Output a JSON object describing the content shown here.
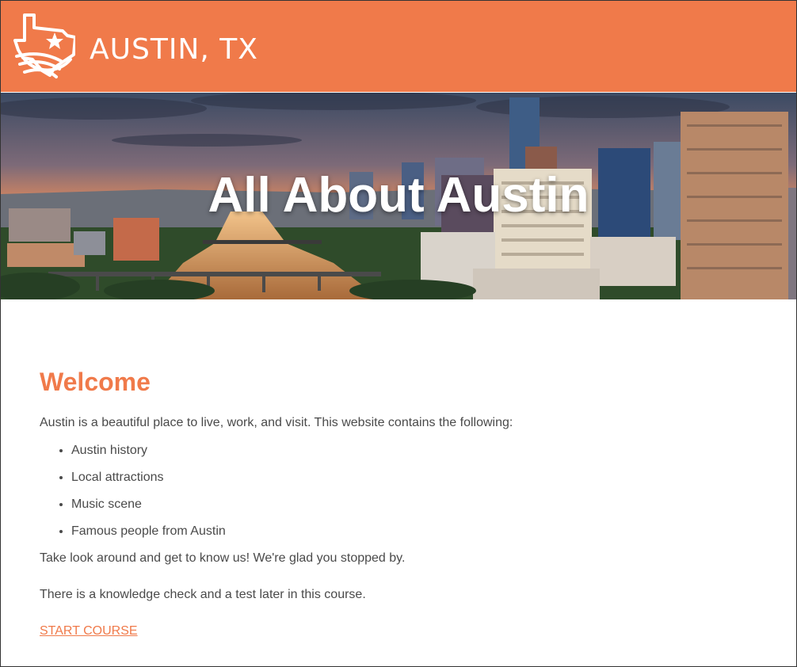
{
  "colors": {
    "brand": "#F07A4A",
    "text": "#4A4A4A",
    "white": "#FFFFFF"
  },
  "header": {
    "logo_icon": "texas-outline-star-icon",
    "title": "AUSTIN, TX"
  },
  "hero": {
    "title": "All About Austin",
    "image": "austin-skyline-photo"
  },
  "main": {
    "heading": "Welcome",
    "intro": "Austin is a beautiful place to live, work, and visit. This website contains the following:",
    "topics": [
      "Austin history",
      "Local attractions",
      "Music scene",
      "Famous people from Austin"
    ],
    "paragraph_2": "Take look around and get to know us! We're glad you stopped by.",
    "paragraph_3": "There is a knowledge check and a test later in this course.",
    "start_link": "START COURSE"
  }
}
